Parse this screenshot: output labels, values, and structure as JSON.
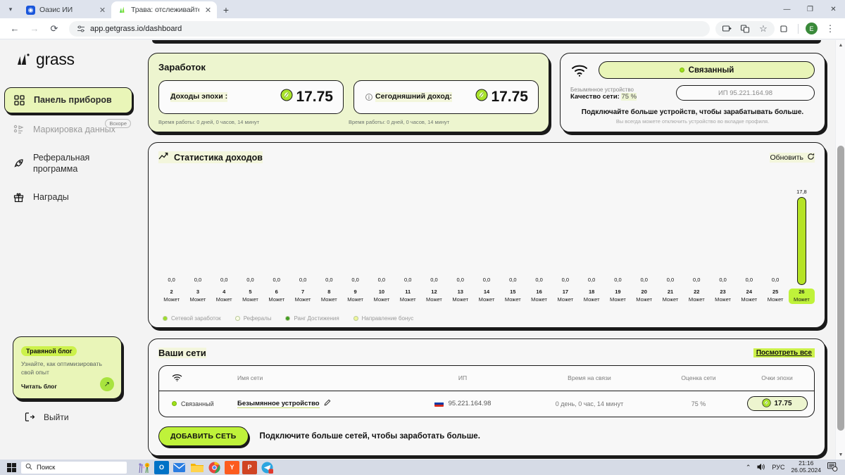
{
  "browser": {
    "tabs": [
      {
        "title": "Оазис ИИ",
        "favicon": "oasis-icon",
        "active": false
      },
      {
        "title": "Трава: отслеживайте свои наг",
        "favicon": "grass-icon",
        "active": true
      }
    ],
    "new_tab_label": "+",
    "window_controls": {
      "minimize": "—",
      "maximize": "❐",
      "close": "✕"
    },
    "nav": {
      "back": "←",
      "forward": "→",
      "reload": "⟳"
    },
    "omnibox": {
      "url": "app.getgrass.io/dashboard",
      "site_settings_icon": "tune-icon"
    },
    "right_icons": [
      "screen-cast-icon",
      "translate-icon",
      "bookmark-star-icon",
      "extensions-icon"
    ],
    "profile_initial": "E",
    "menu_icon": "kebab-menu-icon"
  },
  "sidebar": {
    "brand": "grass",
    "items": [
      {
        "label": "Панель приборов",
        "icon": "dashboard-grid-icon",
        "active": true,
        "badge": ""
      },
      {
        "label": "Маркировка данных",
        "icon": "data-labeling-icon",
        "active": false,
        "badge": "Вскоре"
      },
      {
        "label": "Реферальная программа",
        "icon": "rocket-icon",
        "active": false,
        "badge": ""
      },
      {
        "label": "Награды",
        "icon": "gift-icon",
        "active": false,
        "badge": ""
      }
    ],
    "blog": {
      "tag": "Травяной блог",
      "description": "Узнайте, как оптимизировать свой опыт",
      "cta": "Читать блог",
      "arrow_icon": "arrow-up-right-icon"
    },
    "logout": {
      "label": "Выйти",
      "icon": "logout-icon"
    }
  },
  "earnings": {
    "title": "Заработок",
    "epoch": {
      "label": "Доходы эпохи :",
      "value": "17.75",
      "coin_icon": "grass-coin-icon",
      "uptime": "Время работы: 0 дней, 0 часов, 14 минут"
    },
    "today": {
      "label": "Сегодняшний доход:",
      "value": "17.75",
      "coin_icon": "grass-coin-icon",
      "info_icon": "info-circle-icon",
      "uptime": "Время работы: 0 дней, 0 часов, 14 минут"
    }
  },
  "connection": {
    "wifi_icon": "wifi-icon",
    "status": "Связанный",
    "status_dot_color": "#9ee11a",
    "device_name": "Безымянное устройство",
    "quality_label": "Качество сети:",
    "quality_value": "75 %",
    "ip": "ИП 95.221.164.98",
    "promo_bold": "Подключайте больше устройств, чтобы зарабатывать больше.",
    "promo_sub": "Вы всегда можете отключить устройство во вкладке профиля."
  },
  "chart_panel": {
    "title": "Статистика доходов",
    "title_icon": "line-chart-icon",
    "refresh_label": "Обновить",
    "refresh_icon": "refresh-icon",
    "legend": [
      {
        "label": "Сетевой заработок",
        "color": "#9ede2a"
      },
      {
        "label": "Рефералы",
        "color": "#fbfde8"
      },
      {
        "label": "Ранг Достижения",
        "color": "#3f9d23"
      },
      {
        "label": "Направление бонус",
        "color": "#f0f79a"
      }
    ]
  },
  "chart_data": {
    "type": "bar",
    "title": "Статистика доходов",
    "xlabel": "",
    "ylabel": "",
    "ylim": [
      0,
      17.8
    ],
    "grid": false,
    "legend_position": "bottom",
    "highlighted_category": "26 Может",
    "categories": [
      "2 Может",
      "3 Может",
      "4 Может",
      "5 Может",
      "6 Может",
      "7 Может",
      "8 Может",
      "9 Может",
      "10 Может",
      "11 Может",
      "12 Может",
      "13 Может",
      "14 Может",
      "15 Может",
      "16 Может",
      "17 Может",
      "18 Может",
      "19 Может",
      "20 Может",
      "21 Может",
      "22 Может",
      "23 Может",
      "24 Может",
      "25 Может",
      "26 Может"
    ],
    "day_numbers": [
      "2",
      "3",
      "4",
      "5",
      "6",
      "7",
      "8",
      "9",
      "10",
      "11",
      "12",
      "13",
      "14",
      "15",
      "16",
      "17",
      "18",
      "19",
      "20",
      "21",
      "22",
      "23",
      "24",
      "25",
      "26"
    ],
    "month_label": "Может",
    "value_labels": [
      "0,0",
      "0,0",
      "0,0",
      "0,0",
      "0,0",
      "0,0",
      "0,0",
      "0,0",
      "0,0",
      "0,0",
      "0,0",
      "0,0",
      "0,0",
      "0,0",
      "0,0",
      "0,0",
      "0,0",
      "0,0",
      "0,0",
      "0,0",
      "0,0",
      "0,0",
      "0,0",
      "0,0",
      "17,8"
    ],
    "values": [
      0,
      0,
      0,
      0,
      0,
      0,
      0,
      0,
      0,
      0,
      0,
      0,
      0,
      0,
      0,
      0,
      0,
      0,
      0,
      0,
      0,
      0,
      0,
      0,
      17.8
    ],
    "series": [
      {
        "name": "Сетевой заработок",
        "values": [
          0,
          0,
          0,
          0,
          0,
          0,
          0,
          0,
          0,
          0,
          0,
          0,
          0,
          0,
          0,
          0,
          0,
          0,
          0,
          0,
          0,
          0,
          0,
          0,
          17.8
        ]
      }
    ]
  },
  "networks": {
    "title": "Ваши сети",
    "view_all": "Посмотреть все",
    "columns": [
      "",
      "Имя сети",
      "ИП",
      "Время на связи",
      "Оценка сети",
      "Очки эпохи"
    ],
    "wifi_header_icon": "wifi-icon",
    "rows": [
      {
        "status": "Связанный",
        "name": "Безымянное устройство",
        "edit_icon": "pencil-icon",
        "flag": "ru-flag",
        "ip": "95.221.164.98",
        "uptime": "0 день, 0 час, 14 минут",
        "score": "75 %",
        "points": "17.75",
        "points_icon": "grass-coin-icon"
      }
    ],
    "add_button": "ДОБАВИТЬ СЕТЬ",
    "footer_text": "Подключите больше сетей, чтобы заработать больше."
  },
  "taskbar": {
    "start_icon": "windows-start-icon",
    "search_placeholder": "Поиск",
    "search_icon": "search-icon",
    "apps": [
      {
        "name": "weather-flowers-icon",
        "label": ""
      },
      {
        "name": "outlook-icon",
        "label": "O"
      },
      {
        "name": "mail-icon",
        "label": ""
      },
      {
        "name": "file-explorer-icon",
        "label": ""
      },
      {
        "name": "chrome-icon",
        "label": ""
      },
      {
        "name": "yandex-browser-icon",
        "label": "Y"
      },
      {
        "name": "powerpoint-icon",
        "label": "P"
      },
      {
        "name": "telegram-icon",
        "label": ""
      }
    ],
    "tray": {
      "chevron_icon": "chevron-up-icon",
      "volume_icon": "volume-icon",
      "language": "РУС",
      "time": "21:16",
      "date": "26.05.2024",
      "notifications_icon": "notifications-icon",
      "notifications_count": "14"
    }
  }
}
